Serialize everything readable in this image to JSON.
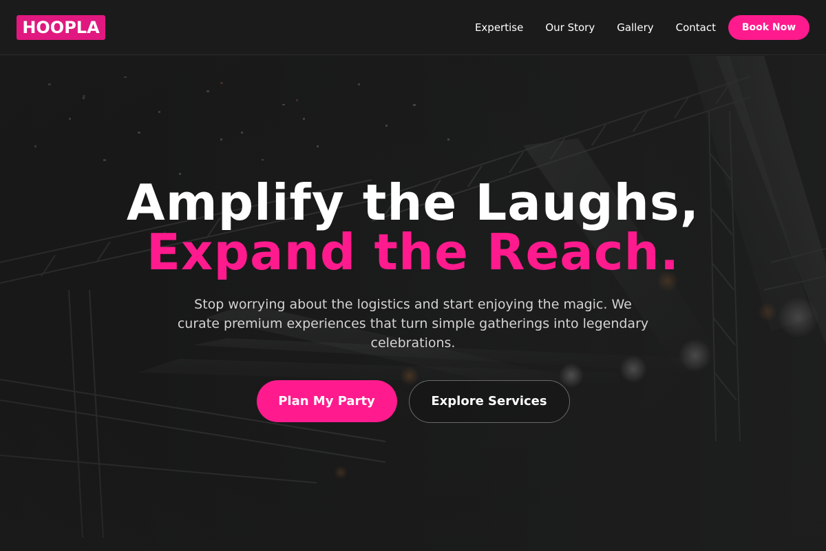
{
  "brand": {
    "logo_text": "HOOPLA",
    "accent_color": "#ff1b8d"
  },
  "nav": {
    "links": [
      {
        "label": "Expertise"
      },
      {
        "label": "Our Story"
      },
      {
        "label": "Gallery"
      },
      {
        "label": "Contact"
      }
    ],
    "cta_label": "Book Now"
  },
  "hero": {
    "background_image": "concert-stage-lights",
    "headline_line1": "Amplify the Laughs,",
    "headline_line2": "Expand the Reach.",
    "subtitle": "Stop worrying about the logistics and start enjoying the magic. We curate premium experiences that turn simple gatherings into legendary celebrations.",
    "primary_cta": "Plan My Party",
    "secondary_cta": "Explore Services"
  }
}
